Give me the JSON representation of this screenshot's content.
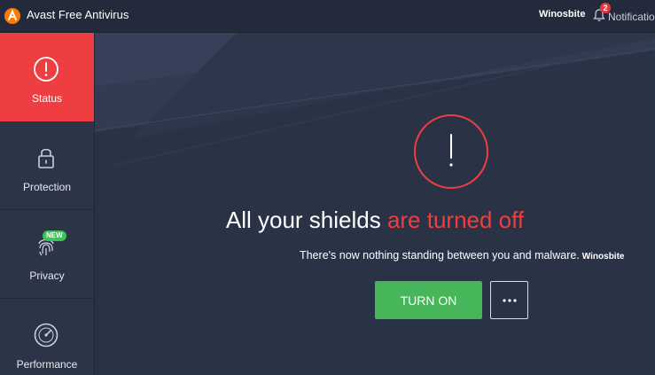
{
  "window": {
    "title": "Avast Free Antivirus",
    "watermark": "Winosbite",
    "notifications": {
      "count": "2",
      "label": "Notifications"
    }
  },
  "sidebar": {
    "items": [
      {
        "label": "Status",
        "icon": "alert-circle-icon",
        "active": true
      },
      {
        "label": "Protection",
        "icon": "lock-icon",
        "active": false
      },
      {
        "label": "Privacy",
        "icon": "fingerprint-icon",
        "active": false,
        "badge": "NEW"
      },
      {
        "label": "Performance",
        "icon": "speedometer-icon",
        "active": false
      }
    ]
  },
  "main": {
    "headline_normal": "All your shields ",
    "headline_warning": "are turned off",
    "subtext": "There's now nothing standing between you and malware.",
    "subtext_watermark": "Winosbite",
    "turn_on_label": "TURN ON",
    "more_icon": "ellipsis-icon"
  },
  "colors": {
    "accent_red": "#ef3e42",
    "turn_on_green": "#47b559",
    "background": "#2a3246",
    "sidebar": "#2c3447",
    "new_badge": "#3ec15a"
  }
}
